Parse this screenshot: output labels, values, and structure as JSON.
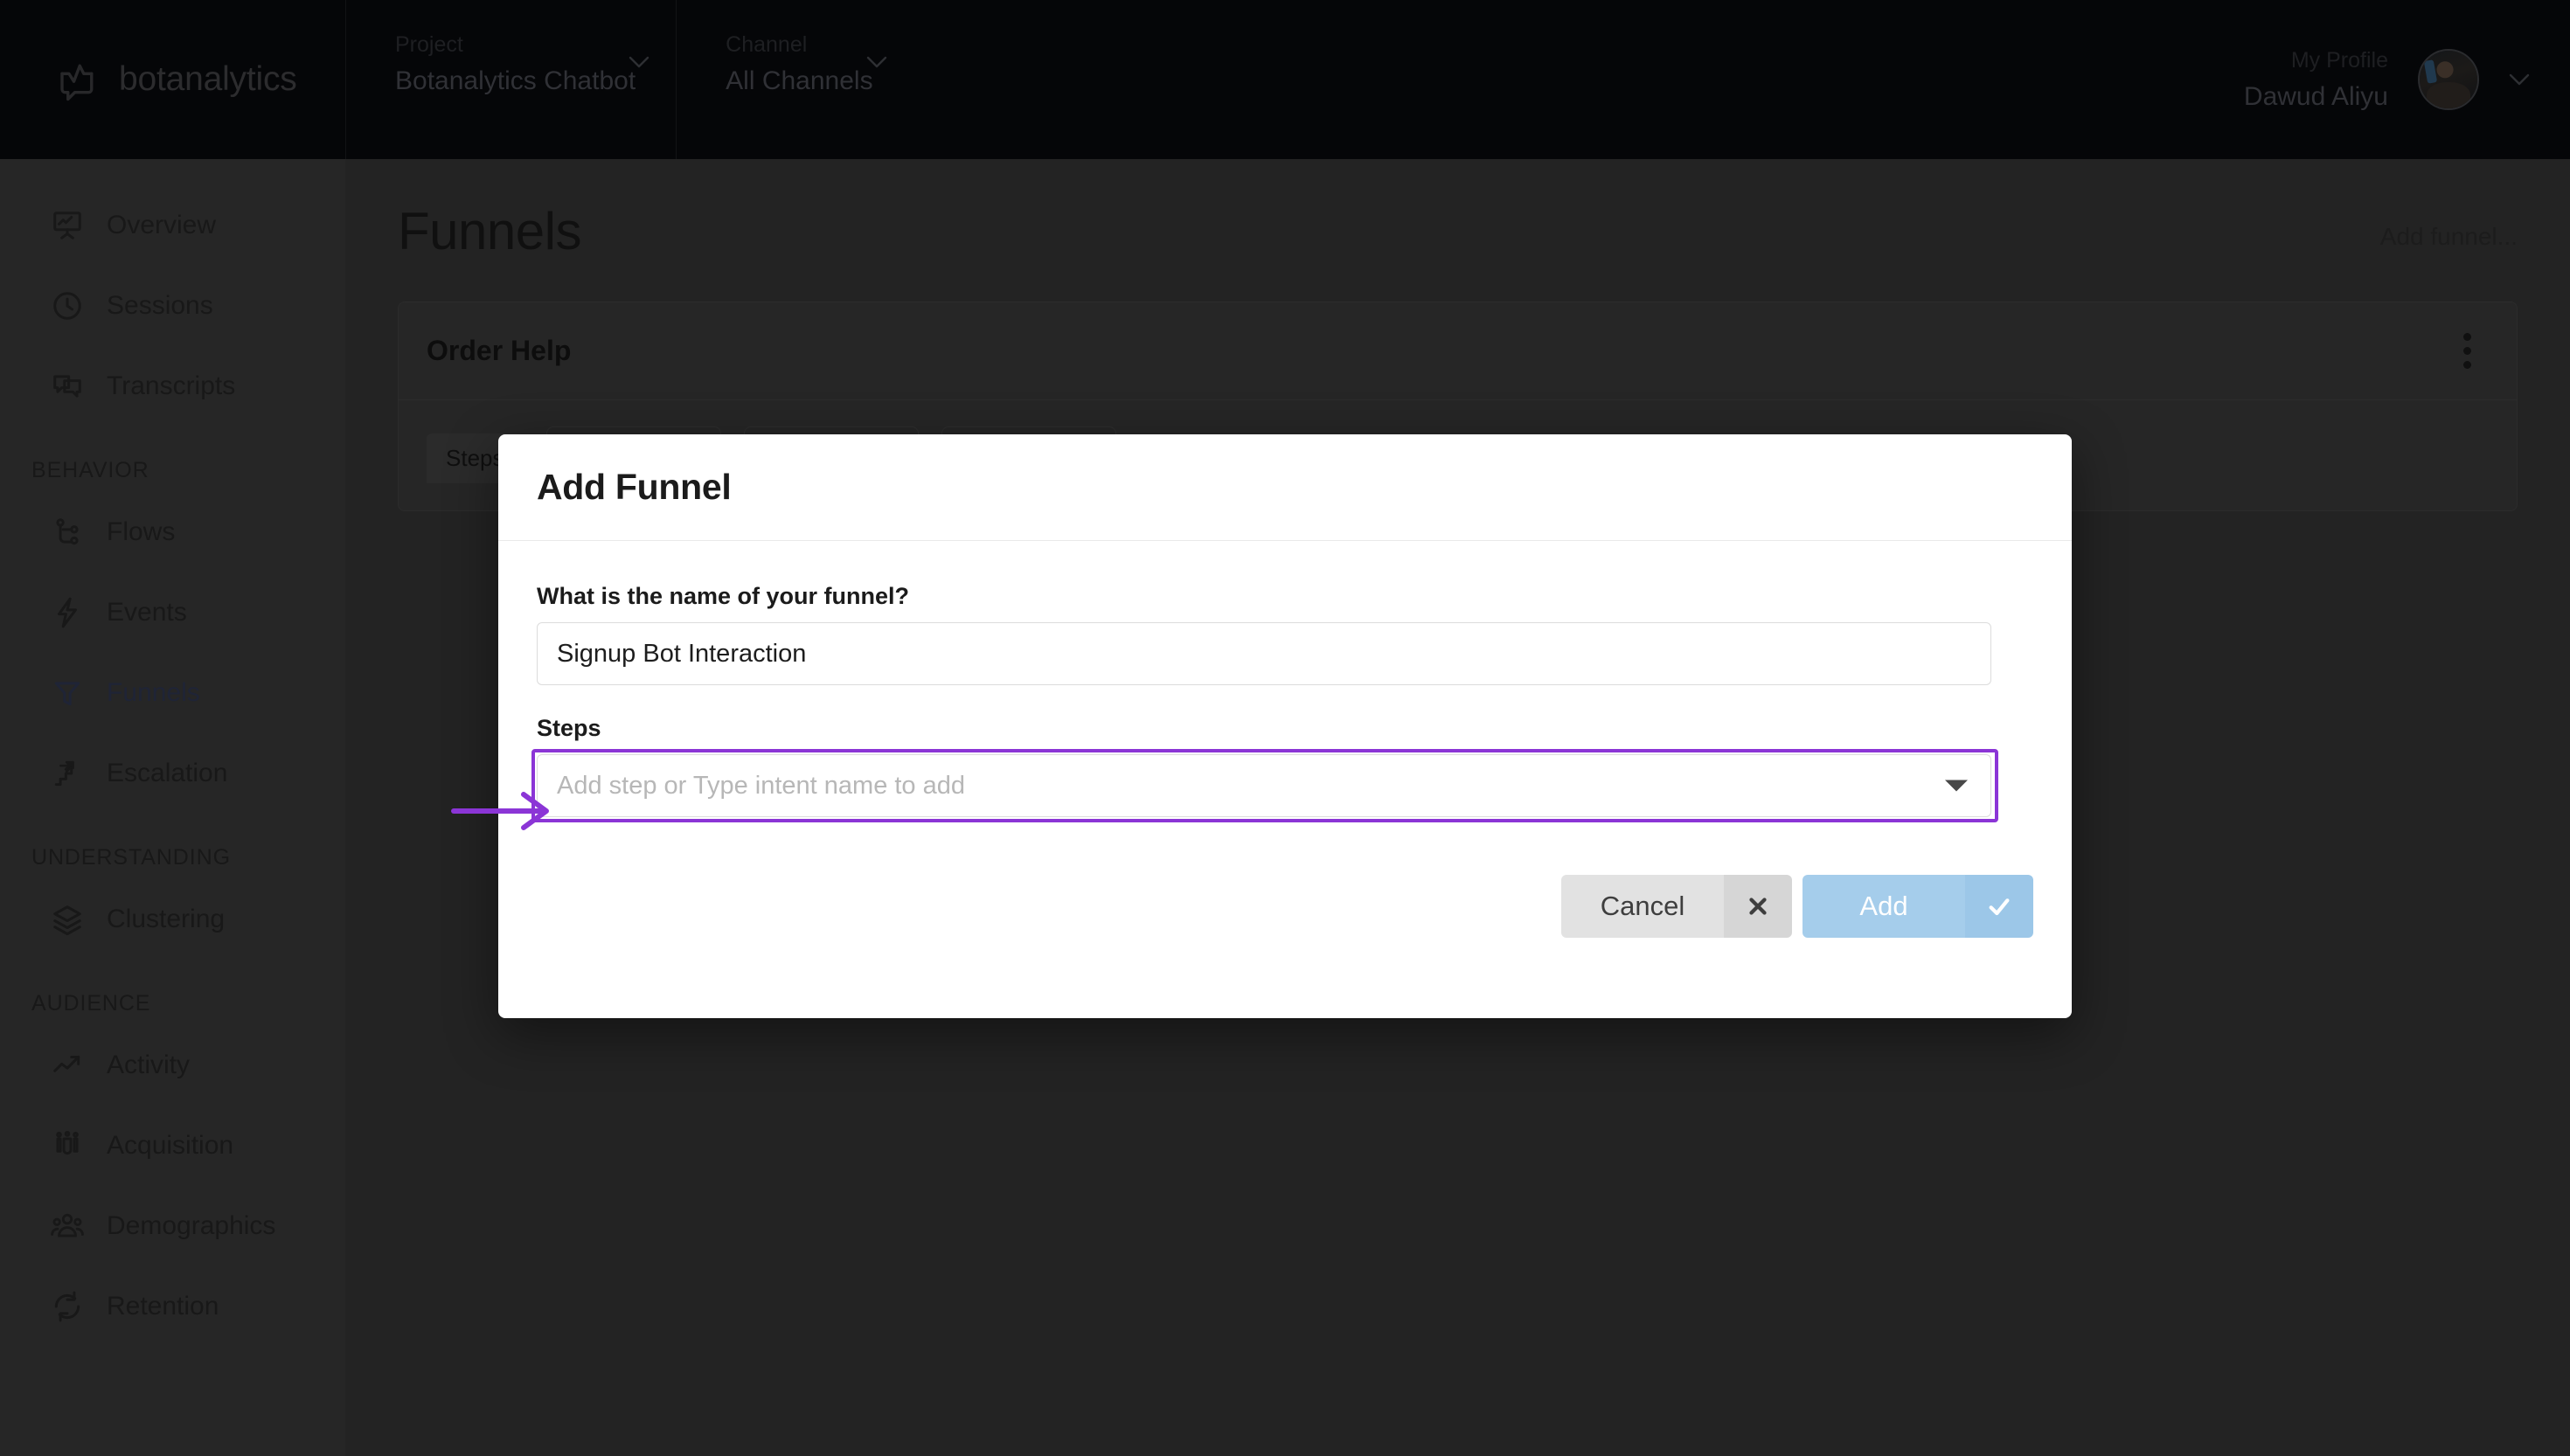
{
  "brand": {
    "name": "botanalytics",
    "logo_icon": "chat-chart-logo-icon"
  },
  "header": {
    "project": {
      "label": "Project",
      "value": "Botanalytics Chatbot",
      "caret_icon": "chevron-down-icon"
    },
    "channel": {
      "label": "Channel",
      "value": "All Channels",
      "caret_icon": "chevron-down-icon"
    },
    "profile": {
      "label": "My Profile",
      "name": "Dawud Aliyu",
      "avatar_icon": "user-avatar",
      "caret_icon": "chevron-down-icon"
    }
  },
  "sidebar": {
    "items": [
      {
        "label": "Overview",
        "icon": "presentation-chart-icon",
        "active": false
      },
      {
        "label": "Sessions",
        "icon": "clock-icon",
        "active": false
      },
      {
        "label": "Transcripts",
        "icon": "chat-bubbles-icon",
        "active": false
      }
    ],
    "sections": [
      {
        "title": "BEHAVIOR",
        "items": [
          {
            "label": "Flows",
            "icon": "flow-nodes-icon",
            "active": false
          },
          {
            "label": "Events",
            "icon": "lightning-icon",
            "active": false
          },
          {
            "label": "Funnels",
            "icon": "funnel-icon",
            "active": true
          },
          {
            "label": "Escalation",
            "icon": "stairs-arrow-icon",
            "active": false
          }
        ]
      },
      {
        "title": "UNDERSTANDING",
        "items": [
          {
            "label": "Clustering",
            "icon": "layers-icon",
            "active": false
          }
        ]
      },
      {
        "title": "AUDIENCE",
        "items": [
          {
            "label": "Activity",
            "icon": "trend-up-icon",
            "active": false
          },
          {
            "label": "Acquisition",
            "icon": "magnet-users-icon",
            "active": false
          },
          {
            "label": "Demographics",
            "icon": "people-group-icon",
            "active": false
          },
          {
            "label": "Retention",
            "icon": "refresh-cycle-icon",
            "active": false
          }
        ]
      }
    ]
  },
  "page": {
    "title": "Funnels",
    "add_funnel_link": "Add funnel...",
    "funnel_card": {
      "title": "Order Help",
      "menu_icon": "kebab-menu-icon",
      "steps_label": "Steps",
      "step_count": 3
    }
  },
  "modal": {
    "title": "Add Funnel",
    "name_field": {
      "label": "What is the name of your funnel?",
      "value": "Signup Bot Interaction",
      "placeholder": ""
    },
    "steps_field": {
      "label": "Steps",
      "placeholder": "Add step or Type intent name to add",
      "value": "",
      "caret_icon": "caret-down-icon",
      "highlighted": true
    },
    "cancel_button": {
      "label": "Cancel",
      "icon": "close-x-icon"
    },
    "add_button": {
      "label": "Add",
      "icon": "check-icon"
    }
  },
  "annotation": {
    "arrow_icon": "right-arrow-annotation",
    "color": "#8B35D6"
  },
  "colors": {
    "accent_purple": "#8B35D6",
    "add_button_blue": "#A5CDEB",
    "cancel_gray": "#E2E2E2",
    "topbar_bg": "#050608",
    "sidebar_bg": "#262626",
    "content_bg": "#232323",
    "modal_bg": "#FFFFFF"
  }
}
